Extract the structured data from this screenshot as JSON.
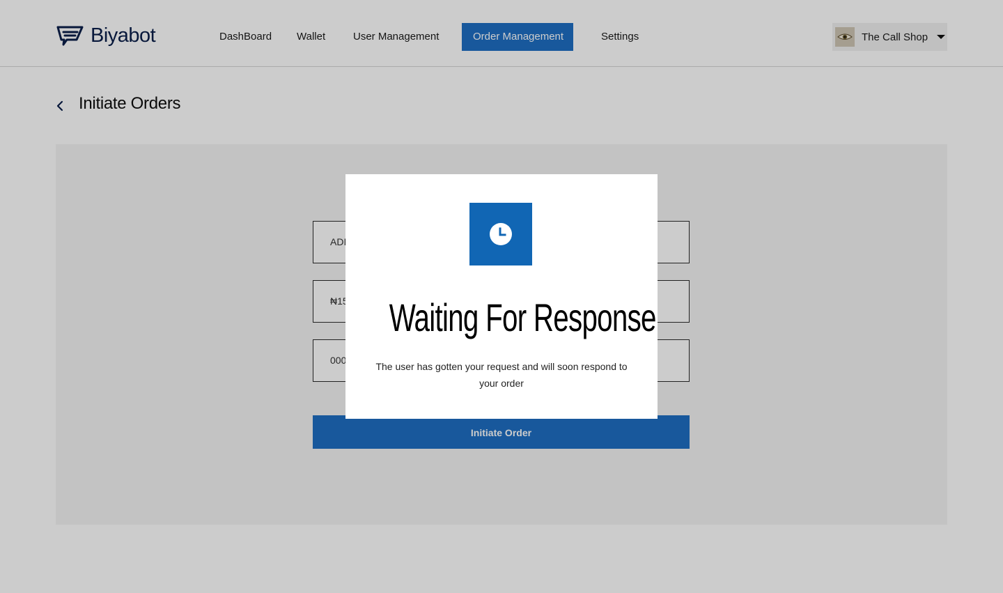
{
  "app": {
    "name": "Biyabot",
    "brand_color": "#1f6fc4",
    "logo_icon": "biyabot-logo-icon"
  },
  "nav": {
    "items": [
      {
        "label": "DashBoard",
        "active": false
      },
      {
        "label": "Wallet",
        "active": false
      },
      {
        "label": "User Management",
        "active": false
      },
      {
        "label": "Order Management",
        "active": true
      },
      {
        "label": "Settings",
        "active": false
      }
    ]
  },
  "user": {
    "name": "The Call Shop",
    "avatar_icon": "eye-avatar-icon"
  },
  "page": {
    "title": "Initiate Orders",
    "back_icon": "chevron-left-icon"
  },
  "form": {
    "fields": [
      {
        "value": "ADI"
      },
      {
        "value": "₦15"
      },
      {
        "value": "000"
      }
    ],
    "submit_label": "Initiate Order"
  },
  "modal": {
    "icon": "clock-icon",
    "title": "Waiting For Response",
    "message": "The user has gotten your request and will soon respond to your order"
  }
}
